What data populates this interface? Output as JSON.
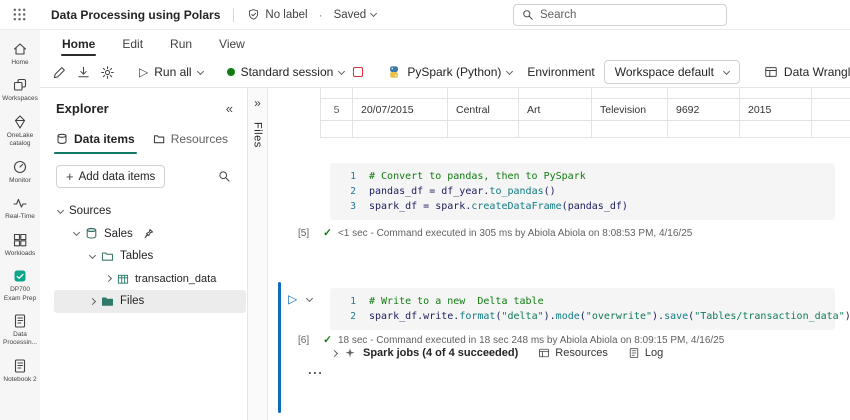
{
  "colors": {
    "accent": "#117865",
    "active_cell_bar": "#0f6cbd",
    "success_green": "#107c10",
    "stop_red": "#d13438"
  },
  "topbar": {
    "app_title": "Data Processing using Polars",
    "sensitivity_label": "No label",
    "save_status": "Saved",
    "search_placeholder": "Search"
  },
  "menu": {
    "items": [
      "Home",
      "Edit",
      "Run",
      "View"
    ]
  },
  "toolbar": {
    "run_all": "Run all",
    "session": "Standard session",
    "kernel": "PySpark (Python)",
    "environment": "Environment",
    "workspace": "Workspace default",
    "wrangler": "Data Wrangler"
  },
  "rail": {
    "items": [
      {
        "label": "Home"
      },
      {
        "label": "Workspaces"
      },
      {
        "label": "OneLake catalog"
      },
      {
        "label": "Monitor"
      },
      {
        "label": "Real-Time"
      },
      {
        "label": "Workloads"
      },
      {
        "label": "DP700 Exam Prep"
      },
      {
        "label": "Data Processin..."
      },
      {
        "label": "Notebook 2"
      }
    ]
  },
  "explorer": {
    "title": "Explorer",
    "tabs": {
      "data_items": "Data items",
      "resources": "Resources"
    },
    "add_button": "Add data items",
    "tree": {
      "sources": "Sources",
      "lakehouse": "Sales",
      "tables_folder": "Tables",
      "table": "transaction_data",
      "files_folder": "Files"
    }
  },
  "files_strip": {
    "label": "Files"
  },
  "grid_fragment": {
    "row_index": "5",
    "cells": [
      "20/07/2015",
      "Central",
      "Art",
      "Television",
      "9692",
      "2015"
    ]
  },
  "cell1": {
    "exec_count": "[5]",
    "status": "<1 sec - Command executed in 305 ms by Abiola Abiola on 8:08:53 PM, 4/16/25",
    "lines": [
      {
        "num": "1",
        "tokens": [
          {
            "c": "cm",
            "t": "# Convert to pandas, then to PySpark"
          }
        ]
      },
      {
        "num": "2",
        "tokens": [
          {
            "c": "pl",
            "t": "pandas_df = df_year."
          },
          {
            "c": "fn",
            "t": "to_pandas"
          },
          {
            "c": "pl",
            "t": "()"
          }
        ]
      },
      {
        "num": "3",
        "tokens": [
          {
            "c": "pl",
            "t": "spark_df = spark."
          },
          {
            "c": "fn",
            "t": "createDataFrame"
          },
          {
            "c": "pl",
            "t": "(pandas_df)"
          }
        ]
      }
    ]
  },
  "cell2": {
    "exec_count": "[6]",
    "status": "18 sec - Command executed in 18 sec 248 ms by Abiola Abiola on 8:09:15 PM, 4/16/25",
    "lines": [
      {
        "num": "1",
        "tokens": [
          {
            "c": "cm",
            "t": "# Write to a new  Delta table"
          }
        ]
      },
      {
        "num": "2",
        "tokens": [
          {
            "c": "pl",
            "t": "spark_df.write."
          },
          {
            "c": "fn",
            "t": "format"
          },
          {
            "c": "pl",
            "t": "("
          },
          {
            "c": "st",
            "t": "\"delta\""
          },
          {
            "c": "pl",
            "t": ")."
          },
          {
            "c": "fn",
            "t": "mode"
          },
          {
            "c": "pl",
            "t": "("
          },
          {
            "c": "st",
            "t": "\"overwrite\""
          },
          {
            "c": "pl",
            "t": ")."
          },
          {
            "c": "fn",
            "t": "save"
          },
          {
            "c": "pl",
            "t": "("
          },
          {
            "c": "st",
            "t": "\"Tables/transaction_data\""
          },
          {
            "c": "pl",
            "t": ")"
          }
        ]
      }
    ]
  },
  "jobs": {
    "label": "Spark jobs (4 of 4 succeeded)",
    "resources": "Resources",
    "log": "Log"
  },
  "more_indicator": "..."
}
